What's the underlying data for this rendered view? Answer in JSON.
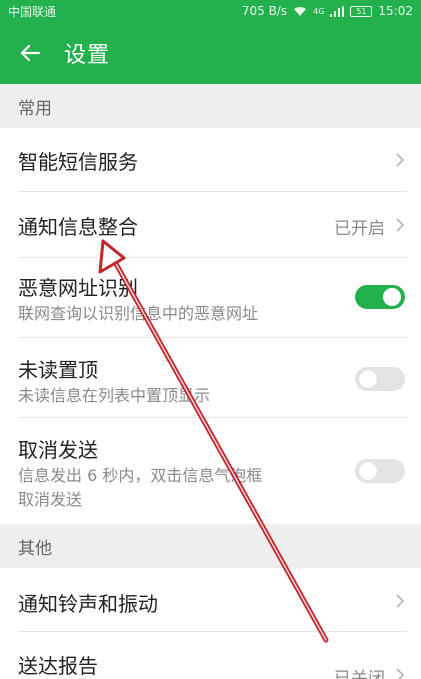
{
  "status_bar": {
    "carrier": "中国联通",
    "speed": "705 B/s",
    "network": "4G",
    "battery": "51",
    "time": "15:02"
  },
  "app_bar": {
    "title": "设置"
  },
  "sections": [
    {
      "header": "常用"
    },
    {
      "header": "其他"
    }
  ],
  "rows": {
    "smart_sms": {
      "label": "智能短信服务"
    },
    "notify_merge": {
      "label": "通知信息整合",
      "value": "已开启"
    },
    "malicious_url": {
      "label": "恶意网址识别",
      "sub": "联网查询以识别信息中的恶意网址",
      "enabled": true
    },
    "unread_top": {
      "label": "未读置顶",
      "sub": "未读信息在列表中置顶显示",
      "enabled": false
    },
    "cancel_send": {
      "label": "取消发送",
      "sub1": "信息发出 6 秒内，双击信息气泡框",
      "sub2": "取消发送",
      "enabled": false
    },
    "ringtone": {
      "label": "通知铃声和振动"
    },
    "delivery_report": {
      "label": "送达报告",
      "value": "已关闭"
    }
  },
  "colors": {
    "accent": "#23b14d",
    "annotation_arrow": "#c0262c"
  }
}
